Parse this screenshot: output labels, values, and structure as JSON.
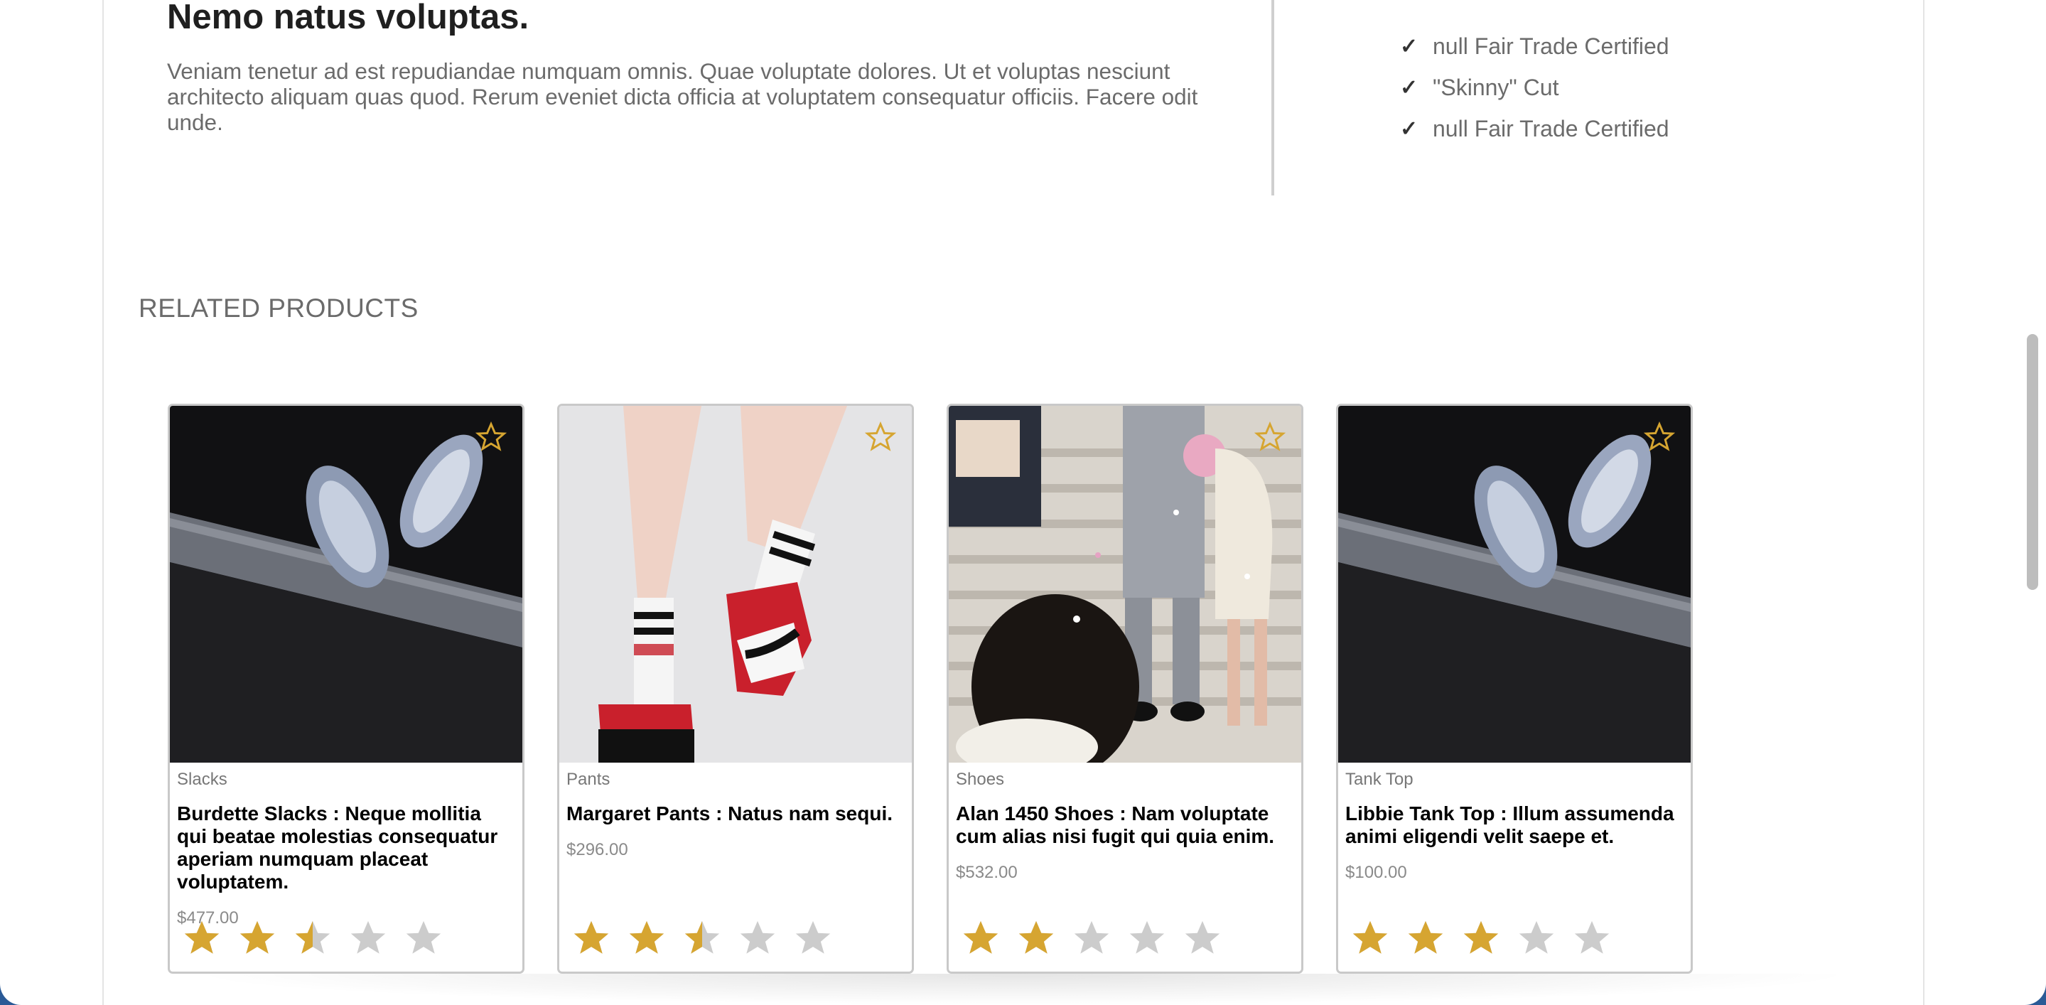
{
  "description": {
    "title": "Nemo natus voluptas.",
    "text": "Veniam tenetur ad est repudiandae numquam omnis. Quae voluptate dolores. Ut et voluptas nesciunt architecto aliquam quas quod. Rerum eveniet dicta officia at voluptatem consequatur officiis. Facere odit unde."
  },
  "features": {
    "check_glyph": "✓",
    "items": [
      "null Fair Trade Certified",
      "\"Skinny\" Cut",
      "null Fair Trade Certified"
    ]
  },
  "related": {
    "heading": "RELATED PRODUCTS",
    "products": [
      {
        "category": "Slacks",
        "title": "Burdette Slacks : Neque mollitia qui beatae molestias consequatur aperiam numquam placeat voluptatem.",
        "price": "$477.00",
        "rating": 2.5,
        "max_rating": 5,
        "image": "sneakers-on-tire"
      },
      {
        "category": "Pants",
        "title": "Margaret Pants : Natus nam sequi.",
        "price": "$296.00",
        "rating": 2.5,
        "max_rating": 5,
        "image": "socks-and-sneakers"
      },
      {
        "category": "Shoes",
        "title": "Alan 1450 Shoes : Nam voluptate cum alias nisi fugit qui quia enim.",
        "price": "$532.00",
        "rating": 2,
        "max_rating": 5,
        "image": "wedding-couple-stairs"
      },
      {
        "category": "Tank Top",
        "title": "Libbie Tank Top : Illum assumenda animi eligendi velit saepe et.",
        "price": "$100.00",
        "rating": 3,
        "max_rating": 5,
        "image": "sneakers-on-tire"
      }
    ]
  },
  "colors": {
    "star_filled": "#d6a531",
    "star_empty": "#cccccc",
    "page_background": "#2a5a96"
  },
  "icons": {
    "favorite": "star-outline-icon",
    "rating": "star-icon",
    "feature": "checkmark-icon"
  }
}
